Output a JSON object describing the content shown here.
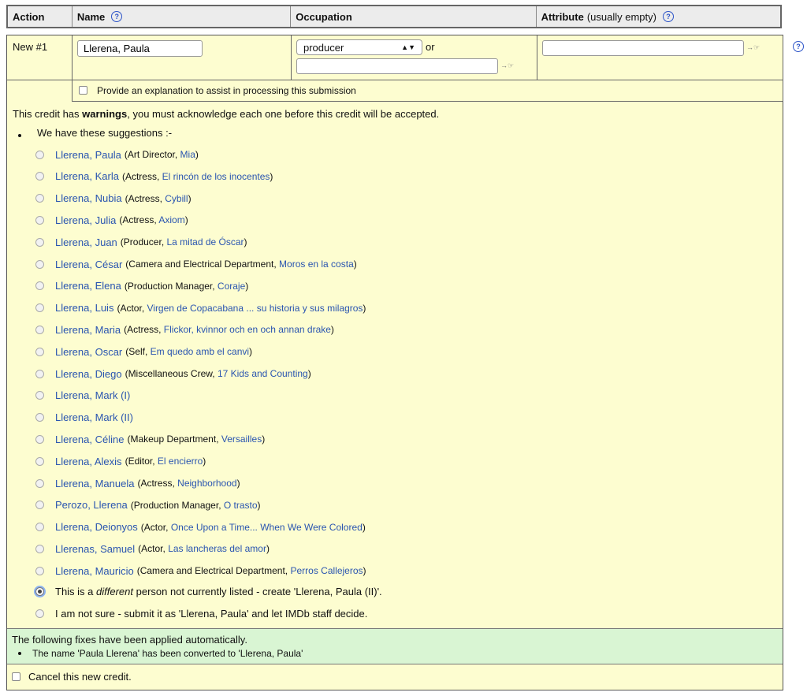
{
  "header": {
    "action": "Action",
    "name": "Name",
    "occupation": "Occupation",
    "attribute": "Attribute",
    "attribute_note": "(usually empty)"
  },
  "row": {
    "label": "New #1",
    "name_value": "Llerena, Paula",
    "occupation_value": "producer",
    "or_text": "or",
    "occupation_text_value": "",
    "attribute_value": "",
    "explain_label": "Provide an explanation to assist in processing this submission"
  },
  "warning": {
    "prefix": "This credit has ",
    "bold": "warnings",
    "suffix": ", you must acknowledge each one before this credit will be accepted."
  },
  "suggestions_heading": "We have these suggestions :-",
  "suggestions": [
    {
      "name": "Llerena, Paula",
      "role": "Art Director",
      "title": "Mia"
    },
    {
      "name": "Llerena, Karla",
      "role": "Actress",
      "title": "El rincón de los inocentes"
    },
    {
      "name": "Llerena, Nubia",
      "role": "Actress",
      "title": "Cybill"
    },
    {
      "name": "Llerena, Julia",
      "role": "Actress",
      "title": "Axiom"
    },
    {
      "name": "Llerena, Juan",
      "role": "Producer",
      "title": "La mitad de Óscar"
    },
    {
      "name": "Llerena, César",
      "role": "Camera and Electrical Department",
      "title": "Moros en la costa"
    },
    {
      "name": "Llerena, Elena",
      "role": "Production Manager",
      "title": "Coraje"
    },
    {
      "name": "Llerena, Luis",
      "role": "Actor",
      "title": "Virgen de Copacabana ... su historia y sus milagros"
    },
    {
      "name": "Llerena, Maria",
      "role": "Actress",
      "title": "Flickor, kvinnor och en och annan drake"
    },
    {
      "name": "Llerena, Oscar",
      "role": "Self",
      "title": "Em quedo amb el canvi"
    },
    {
      "name": "Llerena, Diego",
      "role": "Miscellaneous Crew",
      "title": "17 Kids and Counting"
    },
    {
      "name": "Llerena, Mark (I)",
      "role": "",
      "title": ""
    },
    {
      "name": "Llerena, Mark (II)",
      "role": "",
      "title": ""
    },
    {
      "name": "Llerena, Céline",
      "role": "Makeup Department",
      "title": "Versailles"
    },
    {
      "name": "Llerena, Alexis",
      "role": "Editor",
      "title": "El encierro"
    },
    {
      "name": "Llerena, Manuela",
      "role": "Actress",
      "title": "Neighborhood"
    },
    {
      "name": "Perozo, Llerena",
      "role": "Production Manager",
      "title": "O trasto"
    },
    {
      "name": "Llerena, Deionyos",
      "role": "Actor",
      "title": "Once Upon a Time... When We Were Colored"
    },
    {
      "name": "Llerenas, Samuel",
      "role": "Actor",
      "title": "Las lancheras del amor"
    },
    {
      "name": "Llerena, Mauricio",
      "role": "Camera and Electrical Department",
      "title": "Perros Callejeros"
    }
  ],
  "different_option": {
    "pre": "This is a ",
    "em": "different",
    "post": " person not currently listed - create 'Llerena, Paula (II)'.",
    "selected": true
  },
  "unsure_option": "I am not sure - submit it as 'Llerena, Paula' and let IMDb staff decide.",
  "fixes": {
    "title": "The following fixes have been applied automatically.",
    "items": [
      "The name 'Paula Llerena' has been converted to 'Llerena, Paula'"
    ]
  },
  "cancel_label": "Cancel this new credit.",
  "icons": {
    "help": "help-question-icon",
    "select_arrows": "updown-arrows-icon",
    "field_arrow": "arrow-to-field-icon"
  },
  "colors": {
    "panel_bg": "#fdfdd0",
    "fixes_bg": "#d9f5d3",
    "link": "#2a55b0",
    "help_icon": "#2c54c8"
  }
}
